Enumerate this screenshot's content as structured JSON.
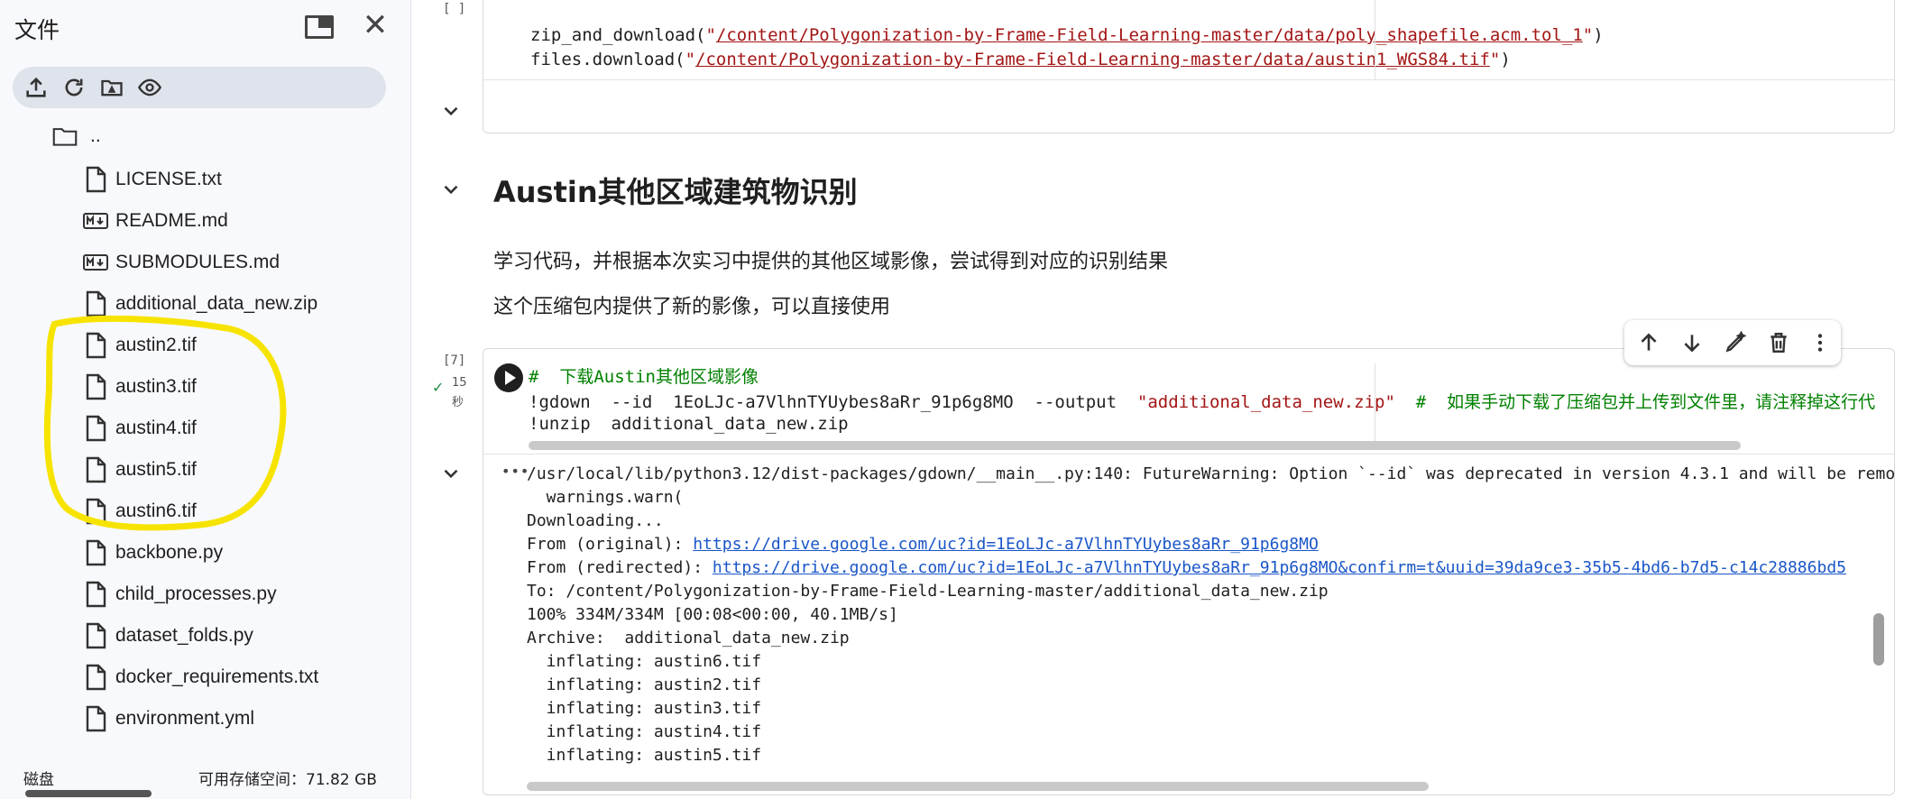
{
  "sidebar": {
    "title": "文件",
    "toolbar_icons": [
      "upload-icon",
      "refresh-icon",
      "folder-drive-icon",
      "eye-icon"
    ],
    "parent_label": "..",
    "files": [
      {
        "name": "LICENSE.txt",
        "icon": "file-icon"
      },
      {
        "name": "README.md",
        "icon": "markdown-icon"
      },
      {
        "name": "SUBMODULES.md",
        "icon": "markdown-icon"
      },
      {
        "name": "additional_data_new.zip",
        "icon": "file-icon"
      },
      {
        "name": "austin2.tif",
        "icon": "file-icon"
      },
      {
        "name": "austin3.tif",
        "icon": "file-icon"
      },
      {
        "name": "austin4.tif",
        "icon": "file-icon"
      },
      {
        "name": "austin5.tif",
        "icon": "file-icon"
      },
      {
        "name": "austin6.tif",
        "icon": "file-icon"
      },
      {
        "name": "backbone.py",
        "icon": "file-icon"
      },
      {
        "name": "child_processes.py",
        "icon": "file-icon"
      },
      {
        "name": "dataset_folds.py",
        "icon": "file-icon"
      },
      {
        "name": "docker_requirements.txt",
        "icon": "file-icon"
      },
      {
        "name": "environment.yml",
        "icon": "file-icon"
      }
    ],
    "footer": {
      "disk_label": "磁盘",
      "storage": "可用存储空间：71.82 GB"
    },
    "annotation_color": "#f7e300"
  },
  "cell1": {
    "exec_label": "[ ]",
    "line1_fn": "zip_and_download(",
    "line1_q1": "\"",
    "line1_path": "/content/Polygonization-by-Frame-Field-Learning-master/data/poly_shapefile.acm.tol_1",
    "line1_q2": "\"",
    "line1_end": ")",
    "line2_fn": "files.download(",
    "line2_q1": "\"",
    "line2_path": "/content/Polygonization-by-Frame-Field-Learning-master/data/austin1_WGS84.tif",
    "line2_q2": "\"",
    "line2_end": ")"
  },
  "section": {
    "heading": "Austin其他区域建筑物识别",
    "para1": "学习代码，并根据本次实习中提供的其他区域影像，尝试得到对应的识别结果",
    "para2": "这个压缩包内提供了新的影像，可以直接使用"
  },
  "cell2": {
    "exec_label": "[7]",
    "duration_num": "15",
    "duration_unit": "秒",
    "comment_line": "#  下载Austin其他区域影像",
    "gdown_cmd": "!gdown  --id  1EoLJc-a7VlhnTYUybes8aRr_91p6g8MO  --output  ",
    "gdown_str": "\"additional_data_new.zip\"",
    "gdown_comment": "  #  如果手动下载了压缩包并上传到文件里，请注释掉这行代",
    "unzip_cmd": "!unzip  additional_data_new.zip",
    "toolbar_icons": [
      "arrow-up-icon",
      "arrow-down-icon",
      "edit-sparkle-icon",
      "trash-icon",
      "more-vert-icon"
    ]
  },
  "output": {
    "menu_label": "•••",
    "lines": [
      "/usr/local/lib/python3.12/dist-packages/gdown/__main__.py:140: FutureWarning: Option `--id` was deprecated in version 4.3.1 and will be remo",
      "  warnings.warn(",
      "Downloading..."
    ],
    "from_original_label": "From (original): ",
    "from_original_url": "https://drive.google.com/uc?id=1EoLJc-a7VlhnTYUybes8aRr_91p6g8MO",
    "from_redirected_label": "From (redirected): ",
    "from_redirected_url": "https://drive.google.com/uc?id=1EoLJc-a7VlhnTYUybes8aRr_91p6g8MO&confirm=t&uuid=39da9ce3-35b5-4bd6-b7d5-c14c28886bd5",
    "lines2": [
      "To: /content/Polygonization-by-Frame-Field-Learning-master/additional_data_new.zip",
      "100% 334M/334M [00:08<00:00, 40.1MB/s]",
      "Archive:  additional_data_new.zip",
      "  inflating: austin6.tif",
      "  inflating: austin2.tif",
      "  inflating: austin3.tif",
      "  inflating: austin4.tif",
      "  inflating: austin5.tif"
    ]
  }
}
